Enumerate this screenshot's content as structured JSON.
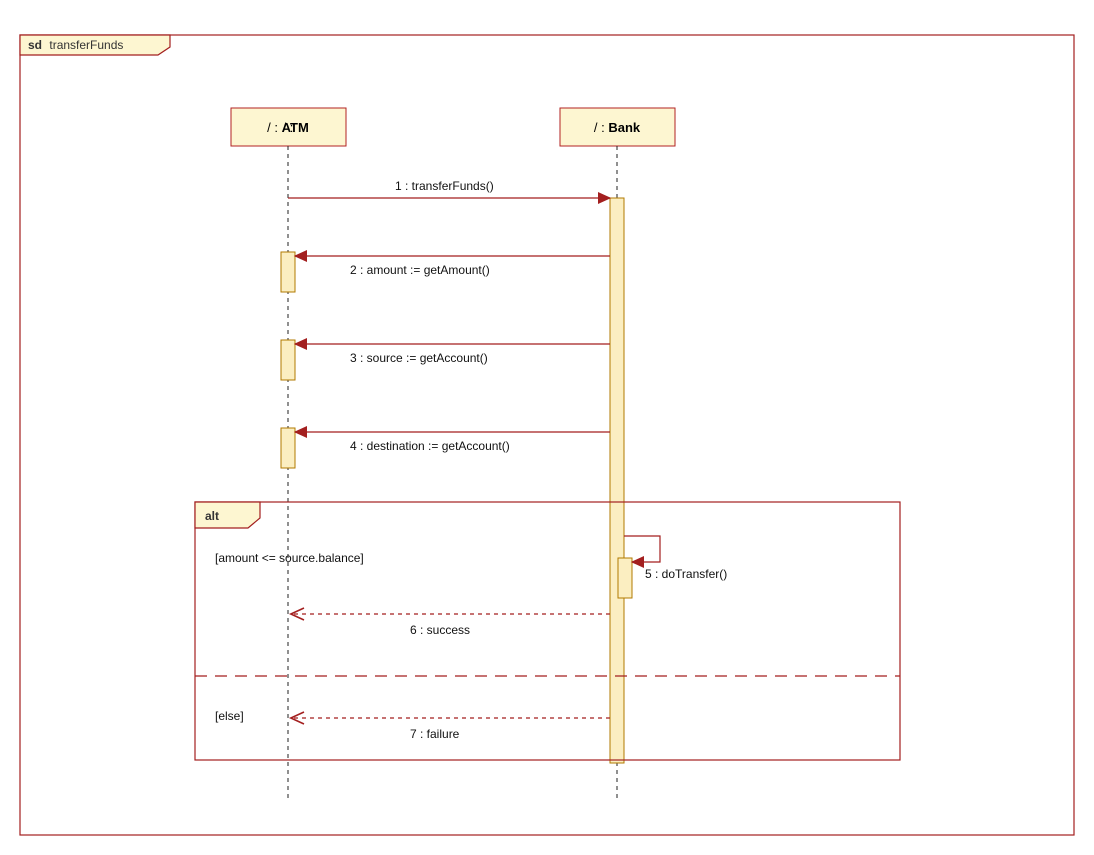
{
  "diagram": {
    "frame_prefix": "sd",
    "frame_name": "transferFunds",
    "lifelines": {
      "atm": "/ : ATM",
      "bank": "/ : Bank"
    },
    "messages": {
      "m1": "1 : transferFunds()",
      "m2": "2 : amount := getAmount()",
      "m3": "3 : source := getAccount()",
      "m4": "4 : destination := getAccount()",
      "m5": "5 : doTransfer()",
      "m6": "6 : success",
      "m7": "7 : failure"
    },
    "alt": {
      "label": "alt",
      "guard1": "[amount <= source.balance]",
      "guard2": "[else]"
    }
  }
}
